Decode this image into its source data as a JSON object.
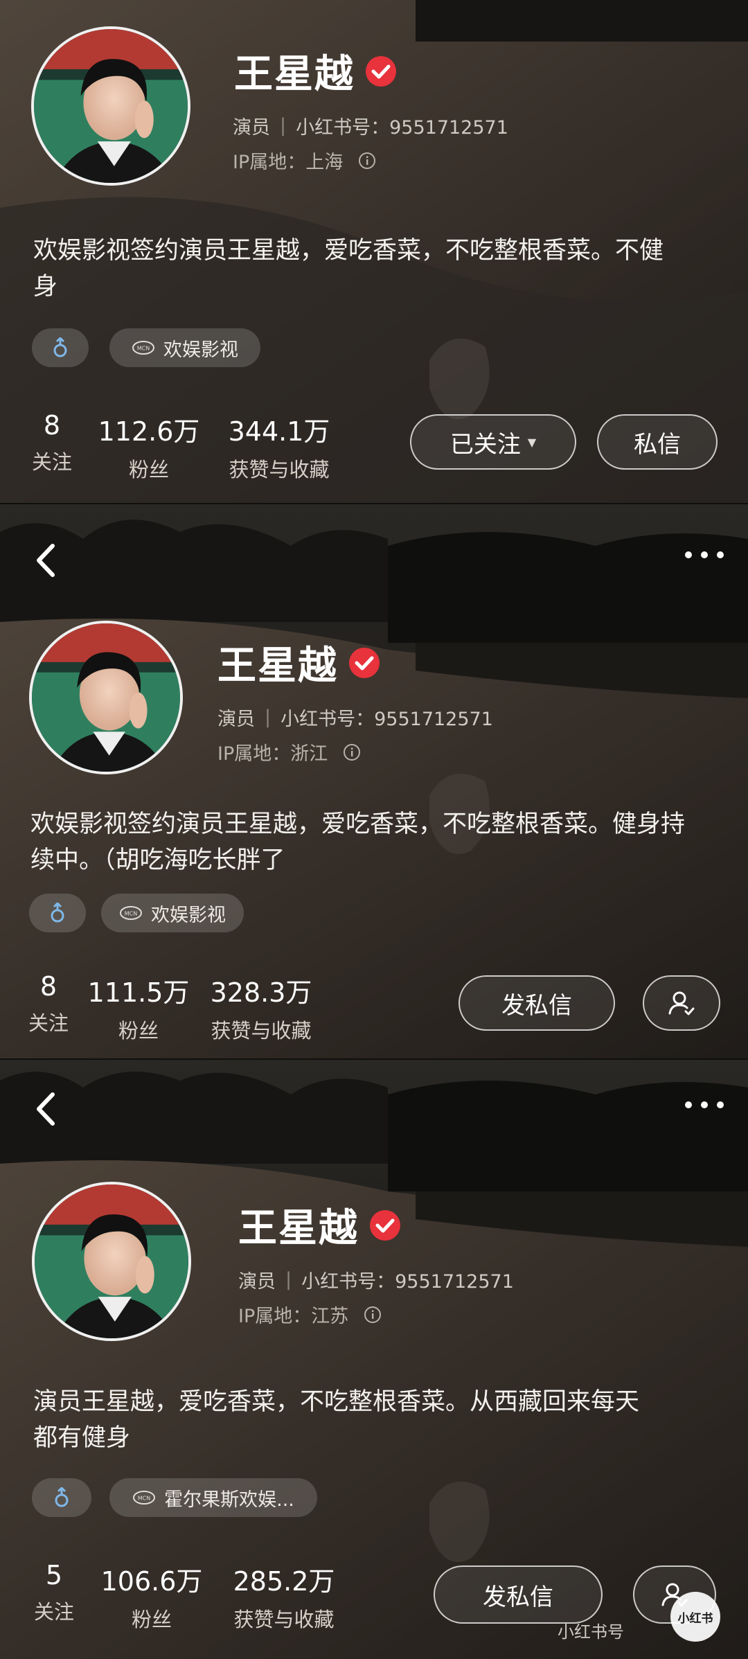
{
  "colors": {
    "verified": "#e8323c",
    "background": "#2b2824"
  },
  "icons": {
    "back": "chevron-left-icon",
    "more": "ellipsis-icon",
    "verified": "verified-check-icon",
    "info": "info-icon",
    "gender": "male-gender-icon",
    "mcn": "mcn-icon",
    "user_check": "user-check-icon"
  },
  "profiles": [
    {
      "name": "王星越",
      "role": "演员",
      "id_label": "小红书号：9551712571",
      "ip_label": "IP属地：上海",
      "bio_lines": [
        "欢娱影视签约演员王星越，爱吃香菜，不吃整根香菜。不健",
        "身"
      ],
      "mcn": "欢娱影视",
      "stats": [
        {
          "value": "8",
          "label": "关注"
        },
        {
          "value": "112.6万",
          "label": "粉丝"
        },
        {
          "value": "344.1万",
          "label": "获赞与收藏"
        }
      ],
      "primary_button": "已关注",
      "secondary_button": "私信"
    },
    {
      "name": "王星越",
      "role": "演员",
      "id_label": "小红书号：9551712571",
      "ip_label": "IP属地：浙江",
      "bio_lines": [
        "欢娱影视签约演员王星越，爱吃香菜，不吃整根香菜。健身持",
        "续中。（胡吃海吃长胖了"
      ],
      "mcn": "欢娱影视",
      "stats": [
        {
          "value": "8",
          "label": "关注"
        },
        {
          "value": "111.5万",
          "label": "粉丝"
        },
        {
          "value": "328.3万",
          "label": "获赞与收藏"
        }
      ],
      "primary_button": "发私信"
    },
    {
      "name": "王星越",
      "role": "演员",
      "id_label": "小红书号：9551712571",
      "ip_label": "IP属地：江苏",
      "bio_lines": [
        "演员王星越，爱吃香菜，不吃整根香菜。从西藏回来每天",
        "都有健身"
      ],
      "mcn": "霍尔果斯欢娱...",
      "stats": [
        {
          "value": "5",
          "label": "关注"
        },
        {
          "value": "106.6万",
          "label": "粉丝"
        },
        {
          "value": "285.2万",
          "label": "获赞与收藏"
        }
      ],
      "primary_button": "发私信"
    }
  ],
  "watermark": {
    "text": "小红书号",
    "logo": "小红书"
  }
}
